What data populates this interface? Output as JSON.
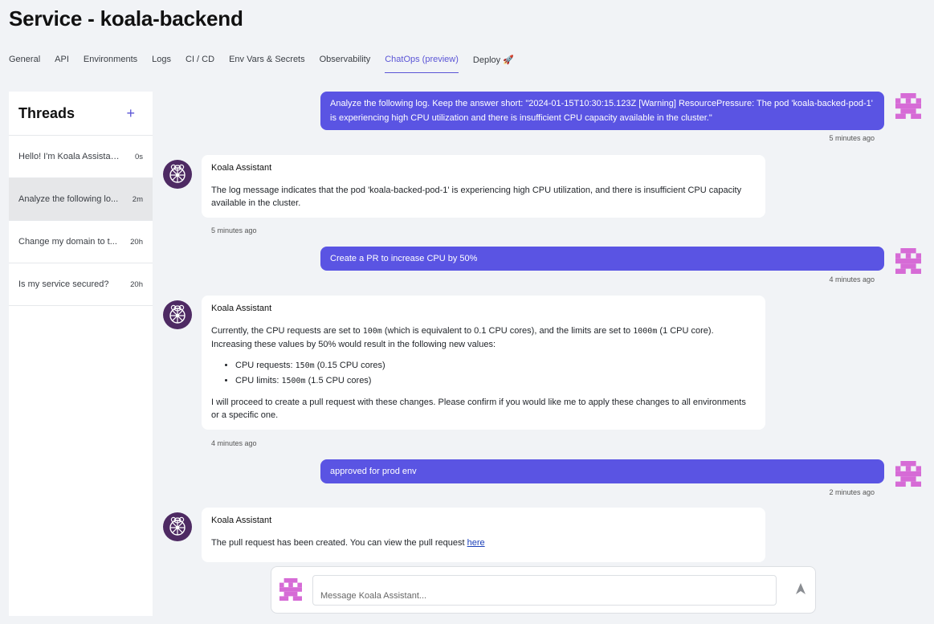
{
  "header": {
    "title": "Service - koala-backend",
    "tabs": [
      {
        "label": "General"
      },
      {
        "label": "API"
      },
      {
        "label": "Environments"
      },
      {
        "label": "Logs"
      },
      {
        "label": "CI / CD"
      },
      {
        "label": "Env Vars & Secrets"
      },
      {
        "label": "Observability"
      },
      {
        "label": "ChatOps (preview)",
        "active": true
      },
      {
        "label": "Deploy 🚀"
      }
    ]
  },
  "sidebar": {
    "title": "Threads",
    "new_icon": "plus-icon",
    "threads": [
      {
        "label": "Hello! I'm Koala Assistant...",
        "time": "0s"
      },
      {
        "label": "Analyze the following lo...",
        "time": "2m",
        "active": true
      },
      {
        "label": "Change my domain to t...",
        "time": "20h"
      },
      {
        "label": "Is my service secured?",
        "time": "20h"
      }
    ]
  },
  "messages": {
    "m1": {
      "text": "Analyze the following log. Keep the answer short: \"2024-01-15T10:30:15.123Z [Warning] ResourcePressure: The pod 'koala-backed-pod-1' is experiencing high CPU utilization and there is insufficient CPU capacity available in the cluster.\"",
      "time": "5 minutes ago"
    },
    "m2": {
      "author": "Koala Assistant",
      "text": "The log message indicates that the pod 'koala-backed-pod-1' is experiencing high CPU utilization, and there is insufficient CPU capacity available in the cluster.",
      "time": "5 minutes ago"
    },
    "m3": {
      "text": "Create a PR to increase CPU by 50%",
      "time": "4 minutes ago"
    },
    "m4": {
      "author": "Koala Assistant",
      "p1_a": "Currently, the CPU requests are set to ",
      "p1_code1": "100m",
      "p1_b": " (which is equivalent to 0.1 CPU cores), and the limits are set to ",
      "p1_code2": "1000m",
      "p1_c": " (1 CPU core). Increasing these values by 50% would result in the following new values:",
      "li1_a": "CPU requests: ",
      "li1_code": "150m",
      "li1_b": " (0.15 CPU cores)",
      "li2_a": "CPU limits: ",
      "li2_code": "1500m",
      "li2_b": " (1.5 CPU cores)",
      "p2": "I will proceed to create a pull request with these changes. Please confirm if you would like me to apply these changes to all environments or a specific one.",
      "time": "4 minutes ago"
    },
    "m5": {
      "text": "approved for prod env",
      "time": "2 minutes ago"
    },
    "m6": {
      "author": "Koala Assistant",
      "text": "The pull request has been created. You can view the pull request ",
      "link": "here"
    }
  },
  "composer": {
    "placeholder": "Message Koala Assistant...",
    "send_icon": "send-arrow-icon"
  },
  "colors": {
    "accent": "#5b55d6",
    "user_bubble": "#5a54e3",
    "bot_avatar": "#4e2a63",
    "user_avatar": "#d66bd6"
  }
}
